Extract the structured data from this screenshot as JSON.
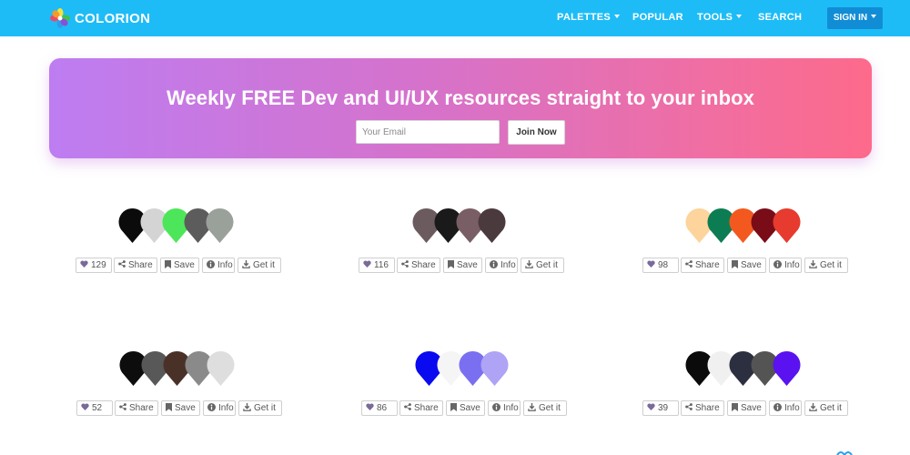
{
  "navbar": {
    "brand": "COLORION",
    "items": [
      {
        "label": "PALETTES",
        "dropdown": true
      },
      {
        "label": "POPULAR",
        "dropdown": false
      },
      {
        "label": "TOOLS",
        "dropdown": true
      },
      {
        "label": "SEARCH",
        "dropdown": false
      }
    ],
    "signin": "SIGN IN"
  },
  "banner": {
    "title": "Weekly FREE Dev and UI/UX resources straight to your inbox",
    "email_placeholder": "Your Email",
    "join_label": "Join Now"
  },
  "actions_labels": {
    "share": "Share",
    "save": "Save",
    "info": "Info",
    "get": "Get it"
  },
  "palettes": [
    {
      "likes": "129",
      "colors": [
        "#0b0b0b",
        "#d4d4d4",
        "#4de65a",
        "#5c5c5c",
        "#9aa19b"
      ]
    },
    {
      "likes": "116",
      "colors": [
        "#6b5b5f",
        "#1a1a1a",
        "#7a5e66",
        "#4b3a3d"
      ]
    },
    {
      "likes": "98",
      "colors": [
        "#fcd49c",
        "#0c7d52",
        "#f3591f",
        "#7a0c18",
        "#e63b2e"
      ]
    },
    {
      "likes": "52",
      "colors": [
        "#0d0d0d",
        "#585858",
        "#4a3128",
        "#8a8a8a",
        "#dedede"
      ]
    },
    {
      "likes": "86",
      "colors": [
        "#0a0af0",
        "#f5f5f5",
        "#7a6ff0",
        "#aea3f5"
      ]
    },
    {
      "likes": "39",
      "colors": [
        "#0b0b0b",
        "#f0f0f0",
        "#2c2f3f",
        "#545454",
        "#5a12f0"
      ]
    }
  ],
  "colors": {
    "nav": "#1ebcf6",
    "signin": "#118dd6",
    "heart": "#7a6a9a"
  }
}
